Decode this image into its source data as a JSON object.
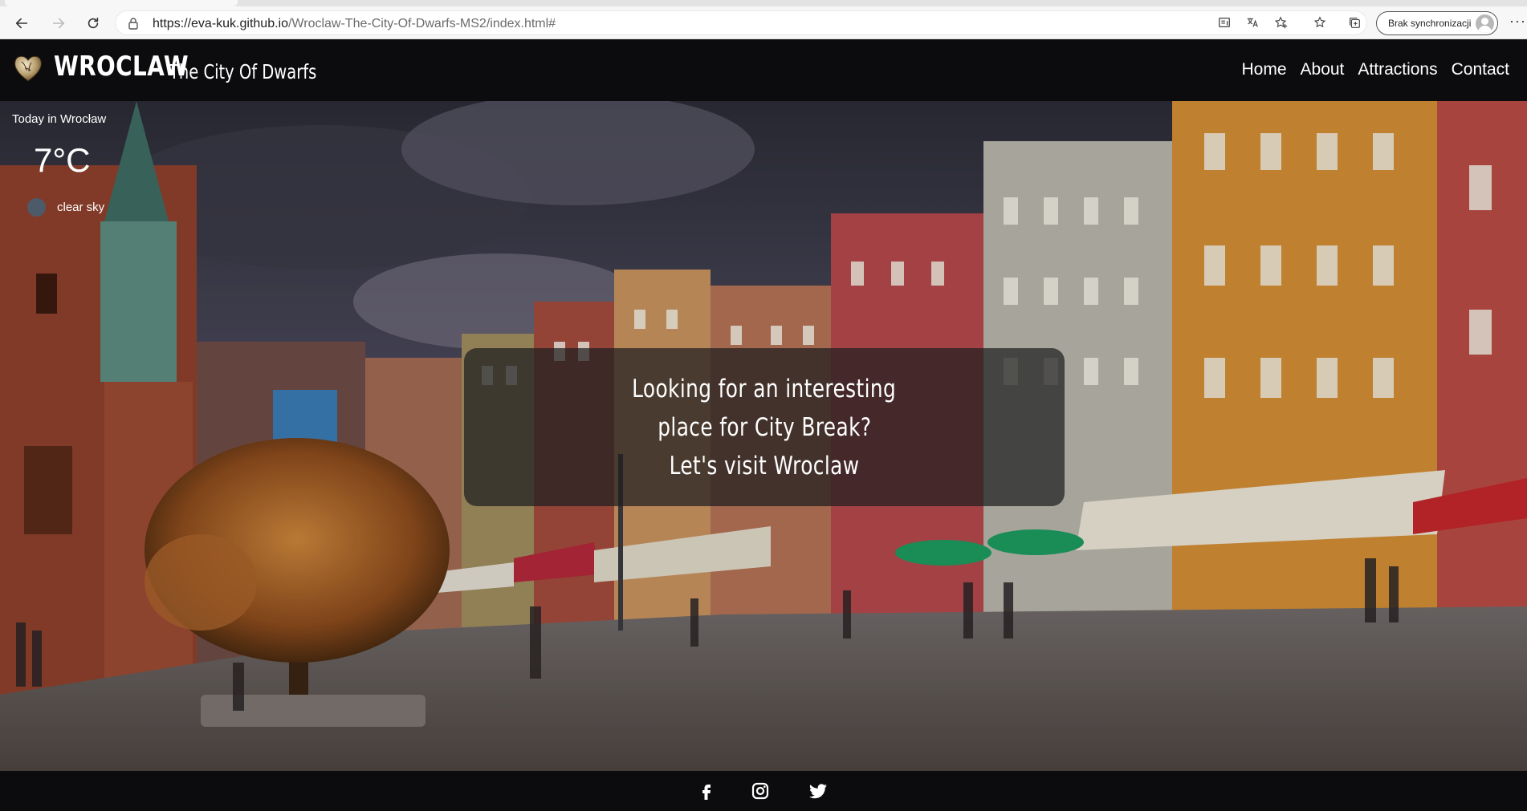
{
  "browser": {
    "url_host": "https://eva-kuk.github.io",
    "url_path": "/Wroclaw-The-City-Of-Dwarfs-MS2/index.html#",
    "sync_label": "Brak synchronizacji",
    "more_label": "···"
  },
  "header": {
    "logo_title": "WROCLAW",
    "logo_subtitle": "The City Of Dwarfs",
    "nav": [
      {
        "label": "Home"
      },
      {
        "label": "About"
      },
      {
        "label": "Attractions"
      },
      {
        "label": "Contact"
      }
    ]
  },
  "weather": {
    "title": "Today in Wrocław",
    "temperature": "7°C",
    "description": "clear sky",
    "icon": "weather-icon"
  },
  "hero": {
    "tagline": [
      "Looking for an interesting",
      "place for City Break?",
      "Let's visit Wroclaw"
    ]
  },
  "footer": {
    "social": [
      "facebook-icon",
      "instagram-icon",
      "twitter-icon"
    ]
  },
  "colors": {
    "header_bg": "#0c0c0e",
    "text": "#ffffff"
  }
}
